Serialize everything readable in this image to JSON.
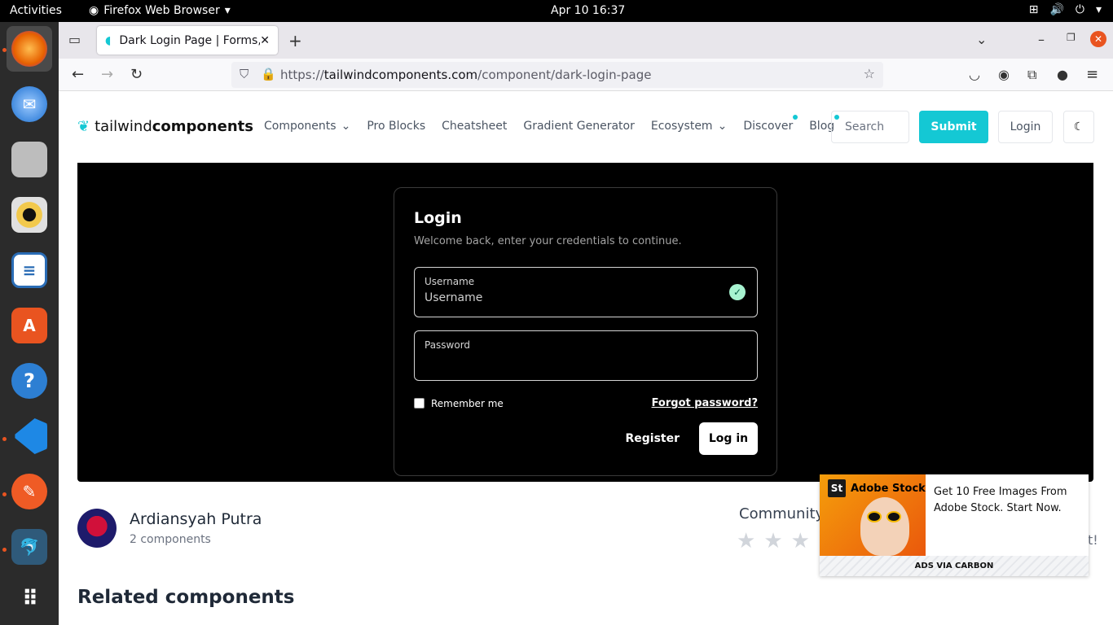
{
  "topbar": {
    "activities": "Activities",
    "app_name": "Firefox Web Browser",
    "clock": "Apr 10  16:37"
  },
  "dock": {
    "items": [
      {
        "name": "firefox",
        "icon": "firefox-icon",
        "color": "#e66000"
      },
      {
        "name": "thunderbird",
        "icon": "thunderbird-icon",
        "color": "#1a6fd1"
      },
      {
        "name": "files",
        "icon": "folder-icon",
        "color": "#9e9e9e"
      },
      {
        "name": "rhythmbox",
        "icon": "rhythmbox-icon",
        "color": "#f2c94c"
      },
      {
        "name": "libreoffice-writer",
        "icon": "writer-icon",
        "color": "#2a6cb5"
      },
      {
        "name": "app-center",
        "icon": "app-center-icon",
        "color": "#e95420"
      },
      {
        "name": "help",
        "icon": "help-icon",
        "color": "#2d7fd3"
      },
      {
        "name": "vscode",
        "icon": "vscode-icon",
        "color": "#1e88e5"
      },
      {
        "name": "postman",
        "icon": "postman-icon",
        "color": "#ef5b25"
      },
      {
        "name": "mysql-workbench",
        "icon": "mysql-workbench-icon",
        "color": "#2f5a7a"
      },
      {
        "name": "show-apps",
        "icon": "grid-icon",
        "color": "#2b2b2b"
      }
    ]
  },
  "browser": {
    "tab_title": "Dark Login Page | Forms, ",
    "url_scheme": "https://",
    "url_host": "tailwindcomponents.com",
    "url_path": "/component/dark-login-page"
  },
  "site": {
    "logo_light": "tailwind",
    "logo_bold": "components",
    "nav": [
      "Components",
      "Pro Blocks",
      "Cheatsheet",
      "Gradient Generator",
      "Ecosystem",
      "Discover",
      "Blog"
    ],
    "search_placeholder": "Search",
    "submit_label": "Submit",
    "login_label": "Login",
    "accent": "#14c8d4"
  },
  "login_card": {
    "title": "Login",
    "subtitle": "Welcome back, enter your credentials to continue.",
    "username_label": "Username",
    "username_placeholder": "Username",
    "password_label": "Password",
    "remember": "Remember me",
    "forgot": "Forgot password?",
    "register": "Register",
    "login_button": "Log in"
  },
  "author": {
    "name": "Ardiansyah Putra",
    "components": "2 components"
  },
  "community": {
    "label": "Community",
    "rating": 0
  },
  "related_heading": "Related components",
  "ad": {
    "brand": "Adobe Stock",
    "badge": "St",
    "text": "Get 10 Free Images From Adobe Stock. Start Now.",
    "via": "ADS VIA CARBON",
    "trailing": "t!"
  }
}
